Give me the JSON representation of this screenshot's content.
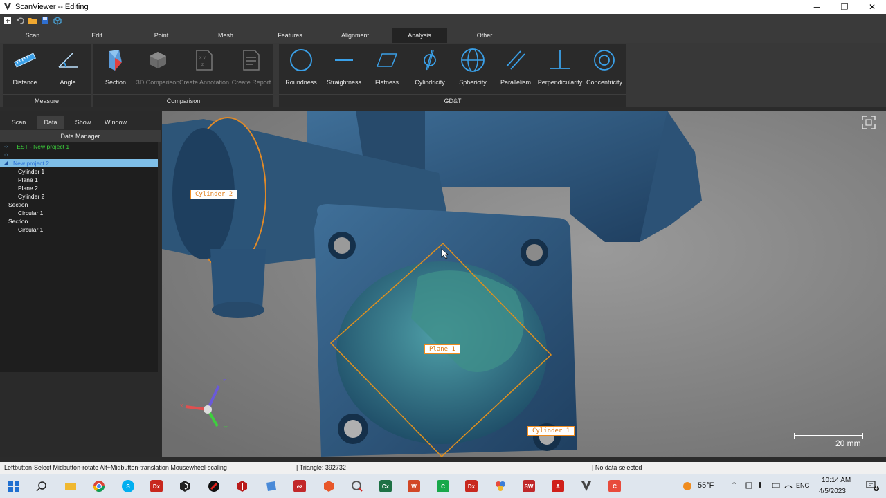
{
  "window": {
    "title": "ScanViewer  --  Editing",
    "controls": [
      "─",
      "❐",
      "✕"
    ]
  },
  "menu_tabs": [
    "Scan",
    "Edit",
    "Point",
    "Mesh",
    "Features",
    "Alignment",
    "Analysis",
    "Other"
  ],
  "active_menu_tab": "Analysis",
  "ribbon": {
    "measure": {
      "label": "Measure",
      "tools": [
        "Distance",
        "Angle"
      ]
    },
    "comparison": {
      "label": "Comparison",
      "tools": [
        "Section",
        "3D Comparison",
        "Create Annotation",
        "Create Report"
      ]
    },
    "gdt": {
      "label": "GD&T",
      "tools": [
        "Roundness",
        "Straightness",
        "Flatness",
        "Cylindricity",
        "Sphericity",
        "Parallelism",
        "Perpendicularity",
        "Concentricity"
      ]
    }
  },
  "panel": {
    "tabs": [
      "Scan",
      "Data",
      "Show",
      "Window"
    ],
    "active_tab": "Data",
    "header": "Data Manager",
    "tree": [
      {
        "text": "TEST - New project 1",
        "color": "#3cd23c"
      },
      {
        "text": "",
        "color": "#3a5fd0"
      },
      {
        "text": "New project 2",
        "color": "#2a6fd6",
        "selected": true
      },
      {
        "text": "Cylinder 1",
        "color": "#ffffff"
      },
      {
        "text": "Plane 1",
        "color": "#ffffff"
      },
      {
        "text": "Plane 2",
        "color": "#ffffff"
      },
      {
        "text": "Cylinder 2",
        "color": "#ffffff"
      },
      {
        "text": "Section",
        "color": "#ffffff"
      },
      {
        "text": "Circular 1",
        "color": "#ffffff"
      },
      {
        "text": "Section",
        "color": "#ffffff"
      },
      {
        "text": "Circular 1",
        "color": "#ffffff"
      }
    ]
  },
  "viewport": {
    "labels": {
      "cylinder2": "Cylinder 2",
      "plane1": "Plane 1",
      "cylinder1": "Cylinder 1"
    },
    "scale": "20 mm",
    "axis": {
      "x": "X",
      "y": "Y",
      "z": "Z"
    }
  },
  "status": {
    "hint": "Leftbutton-Select Midbutton-rotate Alt+Midbutton-translation Mousewheel-scaling",
    "triangles": "| Triangle: 392732",
    "selection": "| No data selected"
  },
  "taskbar": {
    "apps": [
      {
        "name": "chrome",
        "color": "#dd4b39",
        "glyph": ""
      },
      {
        "name": "skype",
        "color": "#00aff0",
        "glyph": "S"
      },
      {
        "name": "dx",
        "color": "#c8281e",
        "glyph": "Dx"
      },
      {
        "name": "app-black",
        "color": "#222222",
        "glyph": ""
      },
      {
        "name": "app-red-circle",
        "color": "#d01515",
        "glyph": ""
      },
      {
        "name": "app-red-hex",
        "color": "#b91b1b",
        "glyph": ""
      },
      {
        "name": "app-blue",
        "color": "#3b7dd8",
        "glyph": ""
      },
      {
        "name": "ezscan",
        "color": "#c2282a",
        "glyph": "ez"
      },
      {
        "name": "app-orange",
        "color": "#e8572a",
        "glyph": ""
      },
      {
        "name": "app-q",
        "color": "#555555",
        "glyph": "Q"
      },
      {
        "name": "excel",
        "color": "#1e7145",
        "glyph": "Cx"
      },
      {
        "name": "word",
        "color": "#d24726",
        "glyph": "W"
      },
      {
        "name": "camtasia",
        "color": "#19a84a",
        "glyph": "C"
      },
      {
        "name": "dx2",
        "color": "#c8281e",
        "glyph": "Dx"
      },
      {
        "name": "app-multi",
        "color": "#8844cc",
        "glyph": ""
      },
      {
        "name": "solidworks",
        "color": "#c0282a",
        "glyph": "SW"
      },
      {
        "name": "acrobat",
        "color": "#d0201a",
        "glyph": "A"
      },
      {
        "name": "scanviewer",
        "color": "#444444",
        "glyph": ""
      },
      {
        "name": "camtasia-rec",
        "color": "#e84b3c",
        "glyph": "C"
      }
    ],
    "weather": "55°F",
    "language": "ENG",
    "time": "10:14 AM",
    "date": "4/5/2023",
    "notification_count": "4"
  }
}
